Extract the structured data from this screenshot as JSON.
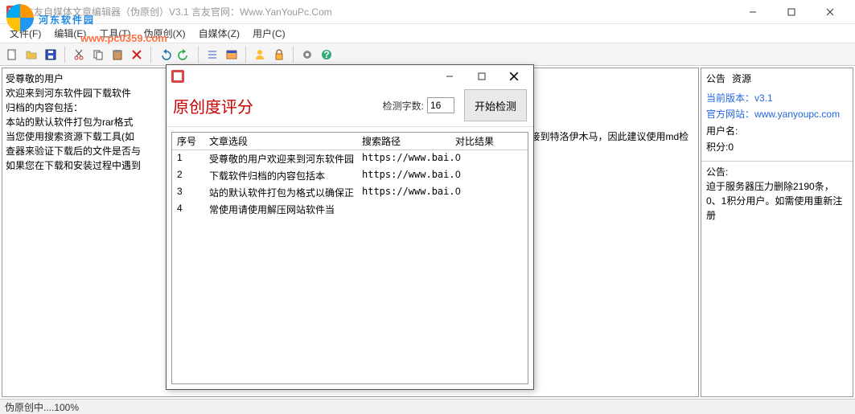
{
  "window": {
    "title": "言友自媒体文章编辑器（伪原创）V3.1 言友官网：Www.YanYouPc.Com"
  },
  "watermark": {
    "text": "河东软件园",
    "url": "www.pc0359.com"
  },
  "menu": {
    "file": "文件(F)",
    "edit": "编辑(E)",
    "tool": "工具(T)",
    "pseudo": "伪原创(X)",
    "media": "自媒体(Z)",
    "user": "用户(C)"
  },
  "toolbar_icons": {
    "new": "new-doc-icon",
    "open": "open-icon",
    "save": "save-icon",
    "cut": "cut-icon",
    "copy": "copy-icon",
    "paste": "paste-icon",
    "delete": "delete-icon",
    "undo": "undo-icon",
    "redo": "redo-icon",
    "list": "list-icon",
    "window": "window-icon",
    "user": "user-icon",
    "lock": "lock-icon",
    "gear": "gear-icon",
    "help": "help-icon"
  },
  "editor": {
    "lines": [
      "受尊敬的用户",
      "欢迎来到河东软件园下载软件",
      "",
      "归档的内容包括：",
      "本站的默认软件打包为rar格式",
      "当您使用搜索资源下载工具(如",
      "查器来验证下载后的文件是否与",
      "如果您在下载和安装过程中遇到"
    ],
    "line_tail": "继接到特洛伊木马，因此建议使用md检"
  },
  "side": {
    "tab1": "公告",
    "tab2": "资源",
    "version_label": "当前版本：",
    "version": "v3.1",
    "site_label": "官方网站：",
    "site": "www.yanyoupc.com",
    "user_label": "用户名:",
    "points_label": "积分:",
    "points": "0",
    "notice_title": "公告:",
    "notice_body": "迫于服务器压力删除2190条，0、1积分用户。如需使用重新注册"
  },
  "status": {
    "text": "伪原创中....100%"
  },
  "dialog": {
    "heading": "原创度评分",
    "count_label": "检测字数:",
    "count_value": "16",
    "start_btn": "开始检测",
    "columns": {
      "c1": "序号",
      "c2": "文章选段",
      "c3": "搜索路径",
      "c4": "对比结果"
    },
    "rows": [
      {
        "idx": "1",
        "seg": "受尊敬的用户欢迎来到河东软件园",
        "path": "https://www.bai...",
        "res": "0"
      },
      {
        "idx": "2",
        "seg": "下载软件归档的内容包括本",
        "path": "https://www.bai...",
        "res": "0"
      },
      {
        "idx": "3",
        "seg": "站的默认软件打包为格式以确保正",
        "path": "https://www.bai...",
        "res": "0"
      },
      {
        "idx": "4",
        "seg": "常使用请使用解压网站软件当",
        "path": "",
        "res": ""
      }
    ]
  }
}
